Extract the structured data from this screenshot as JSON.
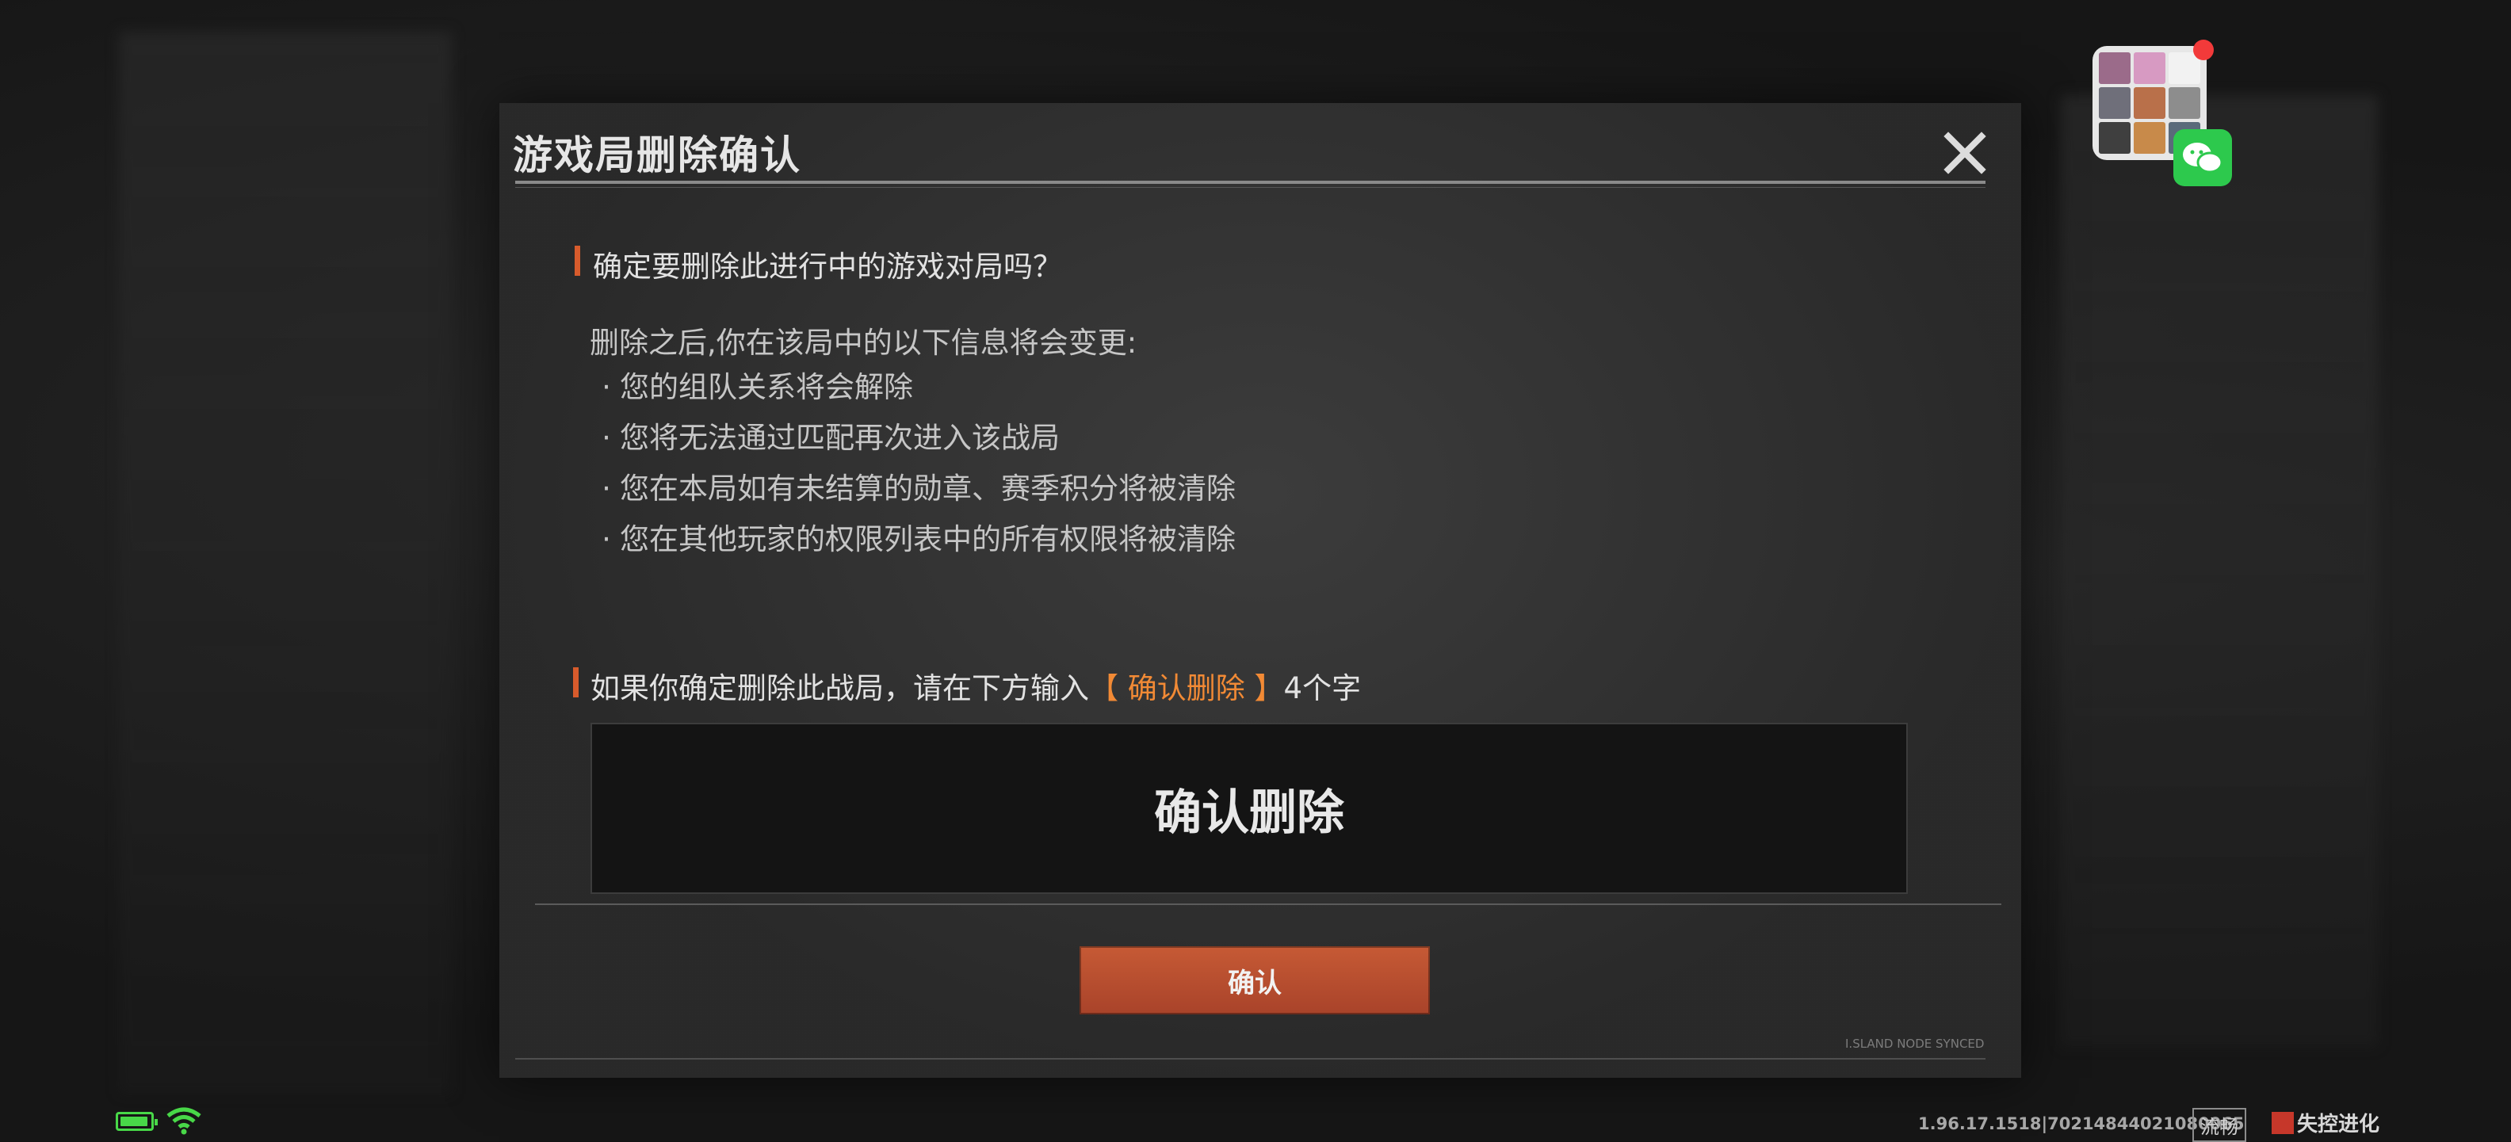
{
  "dialog": {
    "title": "游戏局删除确认",
    "question": "确定要删除此进行中的游戏对局吗？",
    "intro": "删除之后,你在该局中的以下信息将会变更:",
    "bullet_symbol": "·",
    "bullets": [
      "您的组队关系将会解除",
      "您将无法通过匹配再次进入该战局",
      "您在本局如有未结算的勋章、赛季积分将被清除",
      "您在其他玩家的权限列表中的所有权限将被清除"
    ],
    "prompt_before": "如果你确定删除此战局，请在下方输入",
    "prompt_highlight": "【 确认删除 】",
    "prompt_after": "4个字",
    "input_value": "确认删除",
    "confirm_label": "确认",
    "footer_tag": "I.SLAND NODE SYNCED"
  },
  "status_bar": {
    "version": "1.96.17.1518|70214844021080065",
    "quality": "流畅",
    "logo_text": "失控进化"
  },
  "colors": {
    "accent_orange": "#f28a35",
    "button_red": "#b94d2f",
    "marker": "#d75b2c"
  }
}
